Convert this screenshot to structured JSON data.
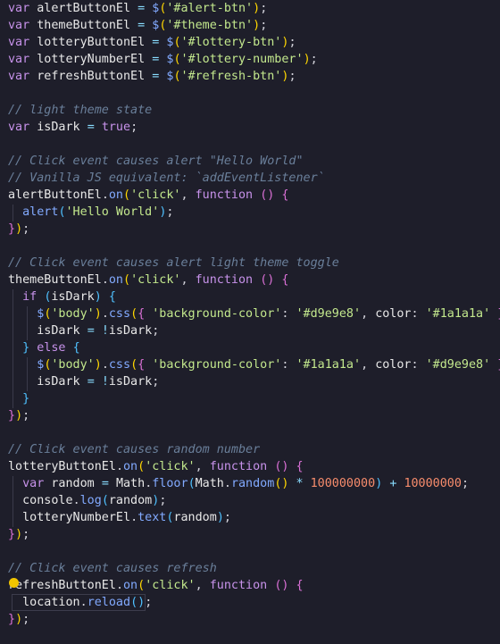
{
  "code": {
    "lines": [
      [
        [
          "kw",
          "var "
        ],
        [
          "var",
          "alertButtonEl "
        ],
        [
          "op",
          "= "
        ],
        [
          "fn",
          "$"
        ],
        [
          "brk",
          "("
        ],
        [
          "str",
          "'#alert-btn'"
        ],
        [
          "brk",
          ")"
        ],
        [
          "plain",
          ";"
        ]
      ],
      [
        [
          "kw",
          "var "
        ],
        [
          "var",
          "themeButtonEl "
        ],
        [
          "op",
          "= "
        ],
        [
          "fn",
          "$"
        ],
        [
          "brk",
          "("
        ],
        [
          "str",
          "'#theme-btn'"
        ],
        [
          "brk",
          ")"
        ],
        [
          "plain",
          ";"
        ]
      ],
      [
        [
          "kw",
          "var "
        ],
        [
          "var",
          "lotteryButtonEl "
        ],
        [
          "op",
          "= "
        ],
        [
          "fn",
          "$"
        ],
        [
          "brk",
          "("
        ],
        [
          "str",
          "'#lottery-btn'"
        ],
        [
          "brk",
          ")"
        ],
        [
          "plain",
          ";"
        ]
      ],
      [
        [
          "kw",
          "var "
        ],
        [
          "var",
          "lotteryNumberEl "
        ],
        [
          "op",
          "= "
        ],
        [
          "fn",
          "$"
        ],
        [
          "brk",
          "("
        ],
        [
          "str",
          "'#lottery-number'"
        ],
        [
          "brk",
          ")"
        ],
        [
          "plain",
          ";"
        ]
      ],
      [
        [
          "kw",
          "var "
        ],
        [
          "var",
          "refreshButtonEl "
        ],
        [
          "op",
          "= "
        ],
        [
          "fn",
          "$"
        ],
        [
          "brk",
          "("
        ],
        [
          "str",
          "'#refresh-btn'"
        ],
        [
          "brk",
          ")"
        ],
        [
          "plain",
          ";"
        ]
      ],
      [],
      [
        [
          "cm",
          "// light theme state"
        ]
      ],
      [
        [
          "kw",
          "var "
        ],
        [
          "var",
          "isDark "
        ],
        [
          "op",
          "= "
        ],
        [
          "kw",
          "true"
        ],
        [
          "plain",
          ";"
        ]
      ],
      [],
      [
        [
          "cm",
          "// Click event causes alert \"Hello World\""
        ]
      ],
      [
        [
          "cm",
          "// Vanilla JS equivalent: `addEventListener`"
        ]
      ],
      [
        [
          "var",
          "alertButtonEl"
        ],
        [
          "plain",
          "."
        ],
        [
          "fn",
          "on"
        ],
        [
          "brk",
          "("
        ],
        [
          "str",
          "'click'"
        ],
        [
          "plain",
          ", "
        ],
        [
          "kw",
          "function "
        ],
        [
          "brk2",
          "()"
        ],
        [
          "plain",
          " "
        ],
        [
          "brk2",
          "{"
        ]
      ],
      [
        [
          "plain",
          "  "
        ],
        [
          "fn",
          "alert"
        ],
        [
          "brk3",
          "("
        ],
        [
          "str",
          "'Hello World'"
        ],
        [
          "brk3",
          ")"
        ],
        [
          "plain",
          ";"
        ]
      ],
      [
        [
          "brk2",
          "}"
        ],
        [
          "brk",
          ")"
        ],
        [
          "plain",
          ";"
        ]
      ],
      [],
      [
        [
          "cm",
          "// Click event causes alert light theme toggle"
        ]
      ],
      [
        [
          "var",
          "themeButtonEl"
        ],
        [
          "plain",
          "."
        ],
        [
          "fn",
          "on"
        ],
        [
          "brk",
          "("
        ],
        [
          "str",
          "'click'"
        ],
        [
          "plain",
          ", "
        ],
        [
          "kw",
          "function "
        ],
        [
          "brk2",
          "()"
        ],
        [
          "plain",
          " "
        ],
        [
          "brk2",
          "{"
        ]
      ],
      [
        [
          "plain",
          "  "
        ],
        [
          "kw",
          "if "
        ],
        [
          "brk3",
          "("
        ],
        [
          "var",
          "isDark"
        ],
        [
          "brk3",
          ")"
        ],
        [
          "plain",
          " "
        ],
        [
          "brk3",
          "{"
        ]
      ],
      [
        [
          "plain",
          "    "
        ],
        [
          "fn",
          "$"
        ],
        [
          "brk",
          "("
        ],
        [
          "str",
          "'body'"
        ],
        [
          "brk",
          ")"
        ],
        [
          "plain",
          "."
        ],
        [
          "fn",
          "css"
        ],
        [
          "brk",
          "("
        ],
        [
          "brk2",
          "{ "
        ],
        [
          "str",
          "'background-color'"
        ],
        [
          "plain",
          ": "
        ],
        [
          "str",
          "'#d9e9e8'"
        ],
        [
          "plain",
          ", "
        ],
        [
          "var",
          "color"
        ],
        [
          "plain",
          ": "
        ],
        [
          "str",
          "'#1a1a1a'"
        ],
        [
          "brk2",
          " }"
        ],
        [
          "brk",
          ")"
        ],
        [
          "plain",
          ";"
        ]
      ],
      [
        [
          "plain",
          "    "
        ],
        [
          "var",
          "isDark "
        ],
        [
          "op",
          "= "
        ],
        [
          "op",
          "!"
        ],
        [
          "var",
          "isDark"
        ],
        [
          "plain",
          ";"
        ]
      ],
      [
        [
          "plain",
          "  "
        ],
        [
          "brk3",
          "}"
        ],
        [
          "kw",
          " else "
        ],
        [
          "brk3",
          "{"
        ]
      ],
      [
        [
          "plain",
          "    "
        ],
        [
          "fn",
          "$"
        ],
        [
          "brk",
          "("
        ],
        [
          "str",
          "'body'"
        ],
        [
          "brk",
          ")"
        ],
        [
          "plain",
          "."
        ],
        [
          "fn",
          "css"
        ],
        [
          "brk",
          "("
        ],
        [
          "brk2",
          "{ "
        ],
        [
          "str",
          "'background-color'"
        ],
        [
          "plain",
          ": "
        ],
        [
          "str",
          "'#1a1a1a'"
        ],
        [
          "plain",
          ", "
        ],
        [
          "var",
          "color"
        ],
        [
          "plain",
          ": "
        ],
        [
          "str",
          "'#d9e9e8'"
        ],
        [
          "brk2",
          " }"
        ],
        [
          "brk",
          ")"
        ],
        [
          "plain",
          ";"
        ]
      ],
      [
        [
          "plain",
          "    "
        ],
        [
          "var",
          "isDark "
        ],
        [
          "op",
          "= "
        ],
        [
          "op",
          "!"
        ],
        [
          "var",
          "isDark"
        ],
        [
          "plain",
          ";"
        ]
      ],
      [
        [
          "plain",
          "  "
        ],
        [
          "brk3",
          "}"
        ]
      ],
      [
        [
          "brk2",
          "}"
        ],
        [
          "brk",
          ")"
        ],
        [
          "plain",
          ";"
        ]
      ],
      [],
      [
        [
          "cm",
          "// Click event causes random number"
        ]
      ],
      [
        [
          "var",
          "lotteryButtonEl"
        ],
        [
          "plain",
          "."
        ],
        [
          "fn",
          "on"
        ],
        [
          "brk",
          "("
        ],
        [
          "str",
          "'click'"
        ],
        [
          "plain",
          ", "
        ],
        [
          "kw",
          "function "
        ],
        [
          "brk2",
          "()"
        ],
        [
          "plain",
          " "
        ],
        [
          "brk2",
          "{"
        ]
      ],
      [
        [
          "plain",
          "  "
        ],
        [
          "kw",
          "var "
        ],
        [
          "var",
          "random "
        ],
        [
          "op",
          "= "
        ],
        [
          "var",
          "Math"
        ],
        [
          "plain",
          "."
        ],
        [
          "fn",
          "floor"
        ],
        [
          "brk3",
          "("
        ],
        [
          "var",
          "Math"
        ],
        [
          "plain",
          "."
        ],
        [
          "fn",
          "random"
        ],
        [
          "brk",
          "()"
        ],
        [
          "plain",
          " "
        ],
        [
          "op",
          "* "
        ],
        [
          "num",
          "100000000"
        ],
        [
          "brk3",
          ")"
        ],
        [
          "plain",
          " "
        ],
        [
          "op",
          "+ "
        ],
        [
          "num",
          "10000000"
        ],
        [
          "plain",
          ";"
        ]
      ],
      [
        [
          "plain",
          "  "
        ],
        [
          "var",
          "console"
        ],
        [
          "plain",
          "."
        ],
        [
          "fn",
          "log"
        ],
        [
          "brk3",
          "("
        ],
        [
          "var",
          "random"
        ],
        [
          "brk3",
          ")"
        ],
        [
          "plain",
          ";"
        ]
      ],
      [
        [
          "plain",
          "  "
        ],
        [
          "var",
          "lotteryNumberEl"
        ],
        [
          "plain",
          "."
        ],
        [
          "fn",
          "text"
        ],
        [
          "brk3",
          "("
        ],
        [
          "var",
          "random"
        ],
        [
          "brk3",
          ")"
        ],
        [
          "plain",
          ";"
        ]
      ],
      [
        [
          "brk2",
          "}"
        ],
        [
          "brk",
          ")"
        ],
        [
          "plain",
          ";"
        ]
      ],
      [],
      [
        [
          "cm",
          "// Click event causes refresh"
        ]
      ],
      [
        [
          "var",
          "refreshButtonEl"
        ],
        [
          "plain",
          "."
        ],
        [
          "fn",
          "on"
        ],
        [
          "brk",
          "("
        ],
        [
          "str",
          "'click'"
        ],
        [
          "plain",
          ", "
        ],
        [
          "kw",
          "function "
        ],
        [
          "brk2",
          "()"
        ],
        [
          "plain",
          " "
        ],
        [
          "brk2",
          "{"
        ]
      ],
      [
        [
          "plain",
          "  "
        ],
        [
          "var",
          "location"
        ],
        [
          "plain",
          "."
        ],
        [
          "fn",
          "reload"
        ],
        [
          "brk3",
          "()"
        ],
        [
          "plain",
          ";"
        ]
      ],
      [
        [
          "brk2",
          "}"
        ],
        [
          "brk",
          ")"
        ],
        [
          "plain",
          ";"
        ]
      ]
    ]
  },
  "theme": {
    "background": "#1e1e2a",
    "keyword": "#c792ea",
    "string": "#c3e88d",
    "function": "#82aaff",
    "comment": "#6a7f9a",
    "number": "#f78c6c"
  },
  "icons": {
    "lightbulb": "lightbulb-icon"
  }
}
